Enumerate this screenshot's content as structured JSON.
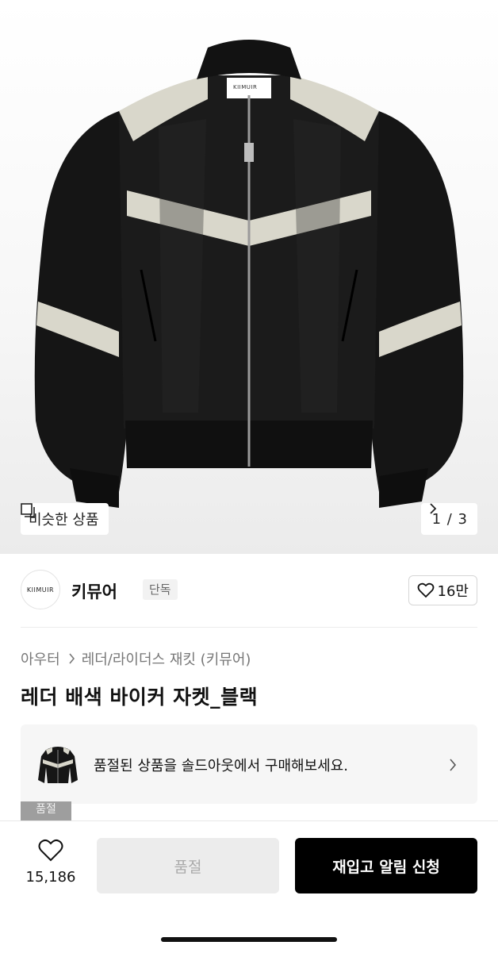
{
  "hero": {
    "image_alt": "black leather biker jacket with cream panels",
    "label_text": "KIIMUIR",
    "similar_label": "비슷한 상품",
    "page_indicator": "1 / 3"
  },
  "brand": {
    "logo_text": "KIIMUIR",
    "name": "키뮤어",
    "badge": "단독",
    "likes": "16만"
  },
  "product": {
    "breadcrumb_parent": "아우터",
    "breadcrumb_child": "레더/라이더스 재킷 (키뮤어)",
    "title": "레더 배색 바이커 자켓_블랙"
  },
  "soldout_banner": {
    "text": "품절된 상품을 솔드아웃에서 구매해보세요.",
    "tag": "품절"
  },
  "bottom_bar": {
    "wish_count": "15,186",
    "soldout_button": "품절",
    "restock_button": "재입고 알림 신청"
  },
  "colors": {
    "jacket": "#161616",
    "panel": "#d9d7cb",
    "accent_button": "#000000",
    "disabled_button": "#ececec"
  },
  "icons": [
    "similar-products-icon",
    "chevron-right-icon",
    "heart-icon",
    "jacket-thumbnail"
  ]
}
